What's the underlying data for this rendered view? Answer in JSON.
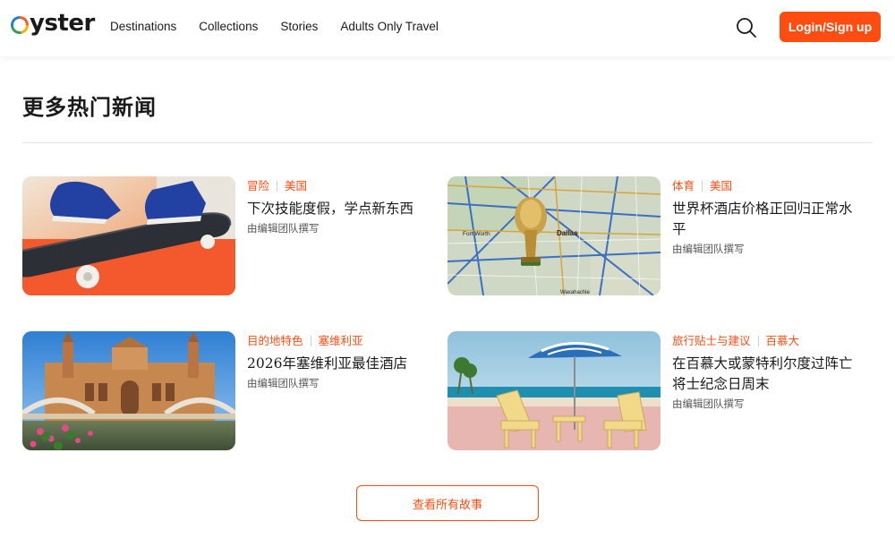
{
  "header": {
    "logo_text": "yster",
    "nav": [
      "Destinations",
      "Collections",
      "Stories",
      "Adults Only Travel"
    ],
    "search_icon": "search-icon",
    "login_label": "Login/Sign up",
    "accent": "#ff4d12"
  },
  "section": {
    "title": "更多热门新闻",
    "more_button": "查看所有故事"
  },
  "cards": [
    {
      "tags": [
        "冒险",
        "美国"
      ],
      "headline": "下次技能度假，学点新东西",
      "byline": "由编辑团队撰写",
      "image": "skateboard-photo"
    },
    {
      "tags": [
        "体育",
        "美国"
      ],
      "headline": "世界杯酒店价格正回归正常水平",
      "byline": "由编辑团队撰写",
      "image": "dallas-map-trophy-photo",
      "map_labels": [
        "Fort Worth",
        "Dallas",
        "Waxahachie"
      ]
    },
    {
      "tags": [
        "目的地特色",
        "塞维利亚"
      ],
      "headline": "2026年塞维利亚最佳酒店",
      "byline": "由编辑团队撰写",
      "image": "seville-plaza-photo"
    },
    {
      "tags": [
        "旅行贴士与建议",
        "百慕大"
      ],
      "headline": "在百慕大或蒙特利尔度过阵亡将士纪念日周末",
      "byline": "由编辑团队撰写",
      "image": "beach-umbrella-chairs-photo"
    }
  ]
}
